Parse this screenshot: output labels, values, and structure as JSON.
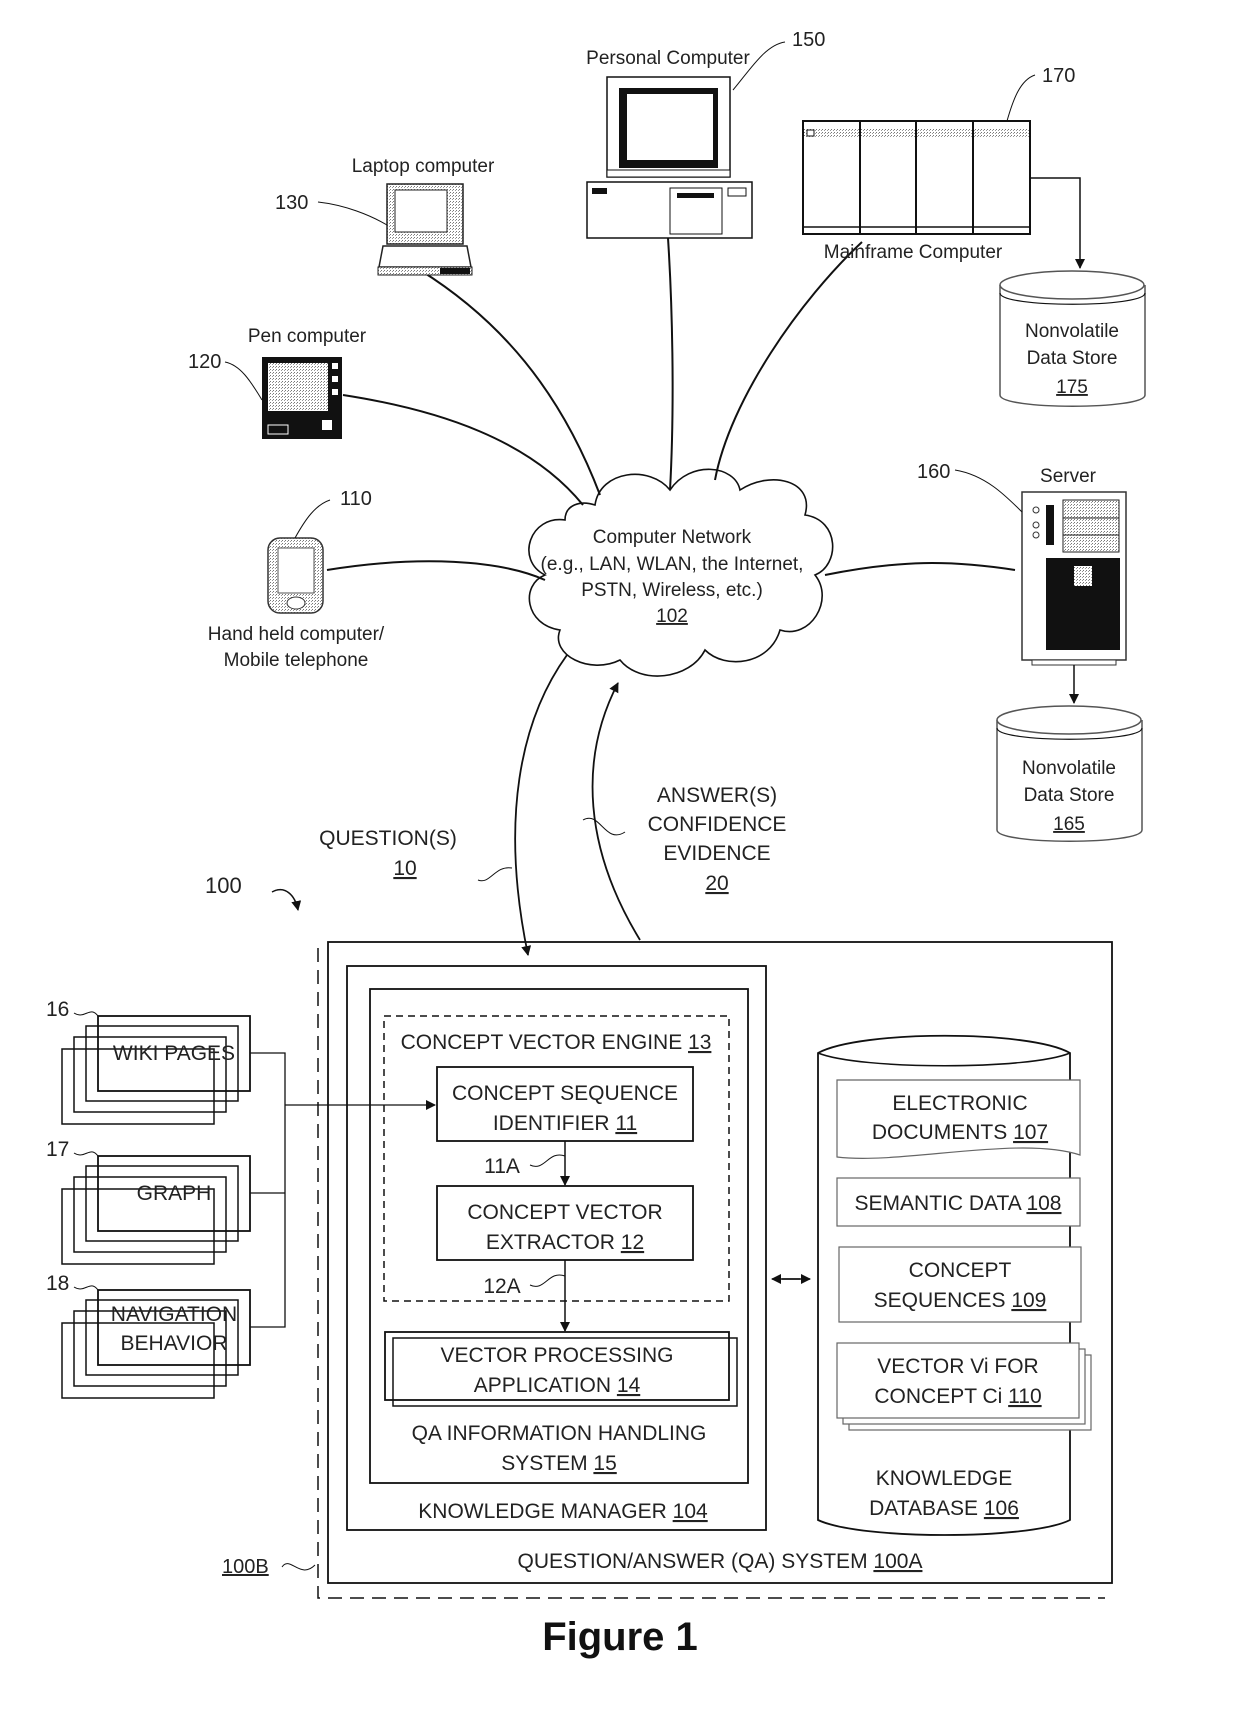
{
  "figure": {
    "caption": "Figure 1",
    "system_ref": "100",
    "outer_boundary_ref": "100B"
  },
  "network": {
    "title": "Computer Network",
    "line1": "(e.g., LAN, WLAN, the Internet,",
    "line2": "PSTN, Wireless, etc.)",
    "ref": "102"
  },
  "devices": [
    {
      "id": "handheld",
      "label_line1": "Hand held computer/",
      "label_line2": "Mobile telephone",
      "ref": "110",
      "icon": "handheld-icon"
    },
    {
      "id": "pen",
      "label_line1": "Pen computer",
      "ref": "120",
      "icon": "pen-computer-icon"
    },
    {
      "id": "laptop",
      "label_line1": "Laptop computer",
      "ref": "130",
      "icon": "laptop-icon"
    },
    {
      "id": "pc",
      "label_line1": "Personal Computer",
      "ref": "150",
      "icon": "desktop-computer-icon"
    },
    {
      "id": "server",
      "label_line1": "Server",
      "ref": "160",
      "icon": "server-icon"
    },
    {
      "id": "mainframe",
      "label_line1": "Mainframe Computer",
      "ref": "170",
      "icon": "mainframe-icon"
    }
  ],
  "data_stores": [
    {
      "id": "store175",
      "line1": "Nonvolatile",
      "line2": "Data Store",
      "ref": "175"
    },
    {
      "id": "store165",
      "line1": "Nonvolatile",
      "line2": "Data Store",
      "ref": "165"
    }
  ],
  "flows": {
    "questions": {
      "label": "QUESTION(S)",
      "ref": "10"
    },
    "answers": {
      "line1": "ANSWER(S)",
      "line2": "CONFIDENCE",
      "line3": "EVIDENCE",
      "ref": "20"
    }
  },
  "sources": [
    {
      "ref": "16",
      "line1": "WIKI PAGES",
      "line2": ""
    },
    {
      "ref": "17",
      "line1": "GRAPH",
      "line2": ""
    },
    {
      "ref": "18",
      "line1": "NAVIGATION",
      "line2": "BEHAVIOR"
    }
  ],
  "qa_system": {
    "label": "QUESTION/ANSWER (QA) SYSTEM ",
    "ref": "100A",
    "knowledge_manager": {
      "label": "KNOWLEDGE MANAGER ",
      "ref": "104"
    },
    "info_handling": {
      "line1": "QA INFORMATION HANDLING",
      "line2": "SYSTEM ",
      "ref": "15"
    },
    "engine": {
      "label": "CONCEPT VECTOR ENGINE ",
      "ref": "13"
    },
    "sequence_identifier": {
      "line1": "CONCEPT SEQUENCE",
      "line2": "IDENTIFIER ",
      "ref": "11",
      "out_ref": "11A"
    },
    "vector_extractor": {
      "line1": "CONCEPT VECTOR",
      "line2": "EXTRACTOR ",
      "ref": "12",
      "out_ref": "12A"
    },
    "processing_app": {
      "line1": "VECTOR PROCESSING",
      "line2": "APPLICATION ",
      "ref": "14"
    }
  },
  "knowledge_db": {
    "line1": "KNOWLEDGE",
    "line2": "DATABASE ",
    "ref": "106",
    "items": [
      {
        "line1": "ELECTRONIC",
        "line2": "DOCUMENTS ",
        "ref": "107"
      },
      {
        "line1": "SEMANTIC DATA ",
        "line2": "",
        "ref": "108"
      },
      {
        "line1": "CONCEPT",
        "line2": "SEQUENCES ",
        "ref": "109"
      },
      {
        "line1": "VECTOR Vi FOR",
        "line2": "CONCEPT Ci ",
        "ref": "110"
      }
    ]
  }
}
